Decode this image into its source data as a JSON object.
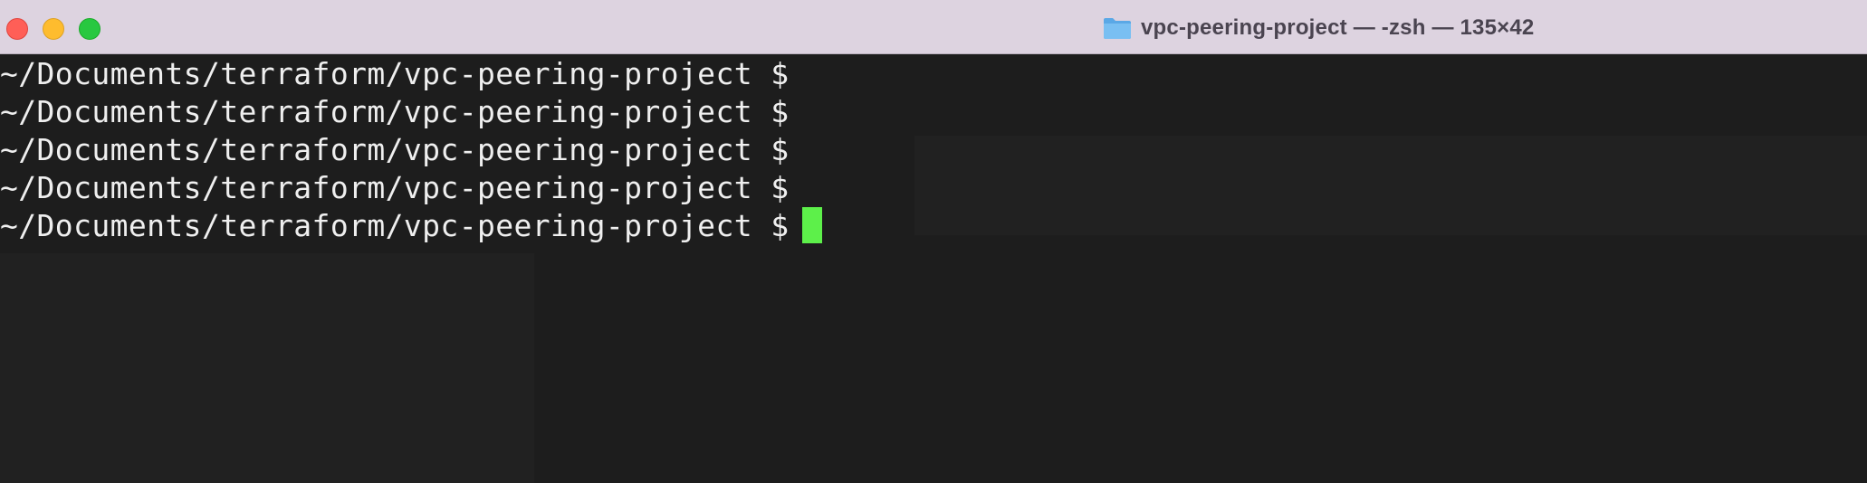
{
  "window": {
    "title": "vpc-peering-project — -zsh — 135×42",
    "title_icon": "folder-icon",
    "buttons": {
      "close": "close",
      "minimize": "minimize",
      "zoom": "zoom"
    }
  },
  "terminal": {
    "lines": [
      "~/Documents/terraform/vpc-peering-project $",
      "~/Documents/terraform/vpc-peering-project $",
      "~/Documents/terraform/vpc-peering-project $",
      "~/Documents/terraform/vpc-peering-project $",
      "~/Documents/terraform/vpc-peering-project $"
    ],
    "cursor_color": "#5df04a",
    "text_color": "#efefef",
    "background_color": "#1d1d1d"
  },
  "colors": {
    "titlebar": "#ddd3e0",
    "close": "#ff5f57",
    "minimize": "#febc2e",
    "zoom": "#28c840"
  }
}
